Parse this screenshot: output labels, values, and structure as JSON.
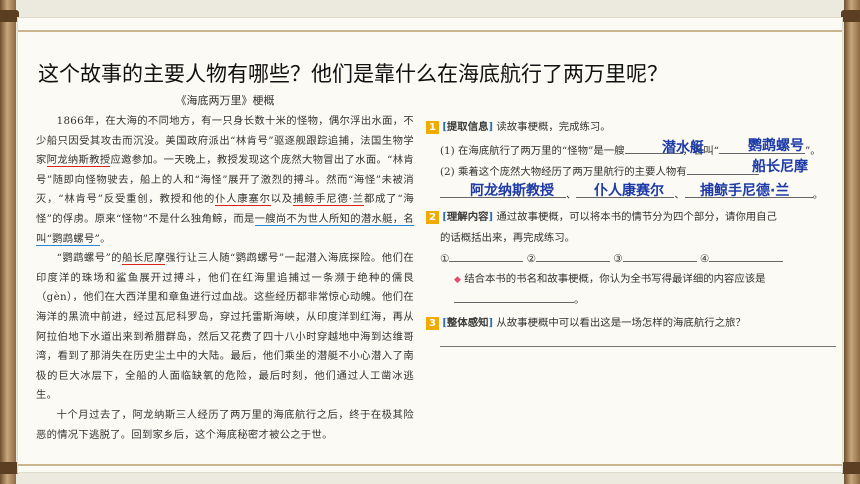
{
  "question": "这个故事的主要人物有哪些？他们是靠什么在海底航行了两万里呢？",
  "story": {
    "title": "《海底两万里》梗概",
    "p1": {
      "a": "1866年，在大海的不同地方，有一只身长数十米的怪物，偶尔浮出水面，不少船只因受其攻击而沉没。美国政府派出“林肯号”驱逐舰跟踪追捕，法国生物学家",
      "b": "阿龙纳斯教授",
      "c": "应邀参加。一天晚上，教授发现这个庞然大物冒出了水面。“林肯号”随即向怪物驶去，船上的人和“海怪”展开了激烈的搏斗。然而“海怪”未被消灭，“林肯号”反受重创，教授和他的",
      "d": "仆人康塞尔",
      "e": "以及",
      "f": "捕鲸手尼德·兰",
      "g": "都成了“海怪”的俘虏。原来“怪物”不是什么独角鲸，而是",
      "h": "一艘尚不为世人所知的潜水艇，名叫“鹦鹉螺号”",
      "i": "。"
    },
    "p2": {
      "a": "“鹦鹉螺号”的",
      "b": "船长尼摩",
      "c": "强行让三人随“鹦鹉螺号”一起潜入海底探险。他们在印度洋的珠场和鲨鱼展开过搏斗，他们在红海里追捕过一条濒于绝种的儒艮（gèn），他们在大西洋里和章鱼进行过血战。这些经历都非常惊心动魄。他们在海洋的黑流中前进，经过瓦尼科罗岛，穿过托雷斯海峡，从印度洋到红海，再从阿拉伯地下水道出来到希腊群岛，然后又花费了四十八小时穿越地中海到达维哥湾，看到了那消失在历史尘土中的大陆。最后，他们乘坐的潜艇不小心潜入了南极的巨大冰层下，全船的人面临缺氧的危险，最后时刻，他们通过人工凿冰逃生。"
    },
    "p3": "十个月过去了，阿龙纳斯三人经历了两万里的海底航行之后，终于在极其险恶的情况下逃脱了。回到家乡后，这个海底秘密才被公之于世。"
  },
  "exercises": {
    "s1": {
      "num": "1",
      "tag": "提取信息",
      "instr": "读故事梗概，完成练习。",
      "q1a": "(1) 在海底航行了两万里的“怪物”是一艘",
      "q1b": "，名叫“",
      "q1c": "”。",
      "q2a": "(2) 乘着这个庞然大物经历了两万里航行的主要人物有",
      "sep1": "、",
      "sep2": "、",
      "sep3": "、",
      "end": "。"
    },
    "s2": {
      "num": "2",
      "tag": "理解内容",
      "instr": "通过故事梗概，可以将本书的情节分为四个部分，请你用自己",
      "instr2": "的话概括出来，再完成练习。",
      "c1": "①",
      "c2": "②",
      "c3": "③",
      "c4": "④",
      "q": "结合本书的书名和故事梗概，你认为全书写得最详细的内容应该是",
      "qend": "。"
    },
    "s3": {
      "num": "3",
      "tag": "整体感知",
      "instr": "从故事梗概中可以看出这是一场怎样的海底航行之旅？"
    }
  },
  "handwriting": {
    "ans_sub": "潜水艇",
    "ans_name": "鹦鹉螺号",
    "ans_captain": "船长尼摩",
    "ans_prof": "阿龙纳斯教授",
    "ans_servant": "仆人康赛尔",
    "ans_whaler": "捕鲸手尼德·兰"
  },
  "colors": {
    "underline_red": "#d9261c",
    "underline_blue": "#2a86d9",
    "handwriting_blue": "#1d3aa8",
    "number_badge": "#f0ab00"
  }
}
